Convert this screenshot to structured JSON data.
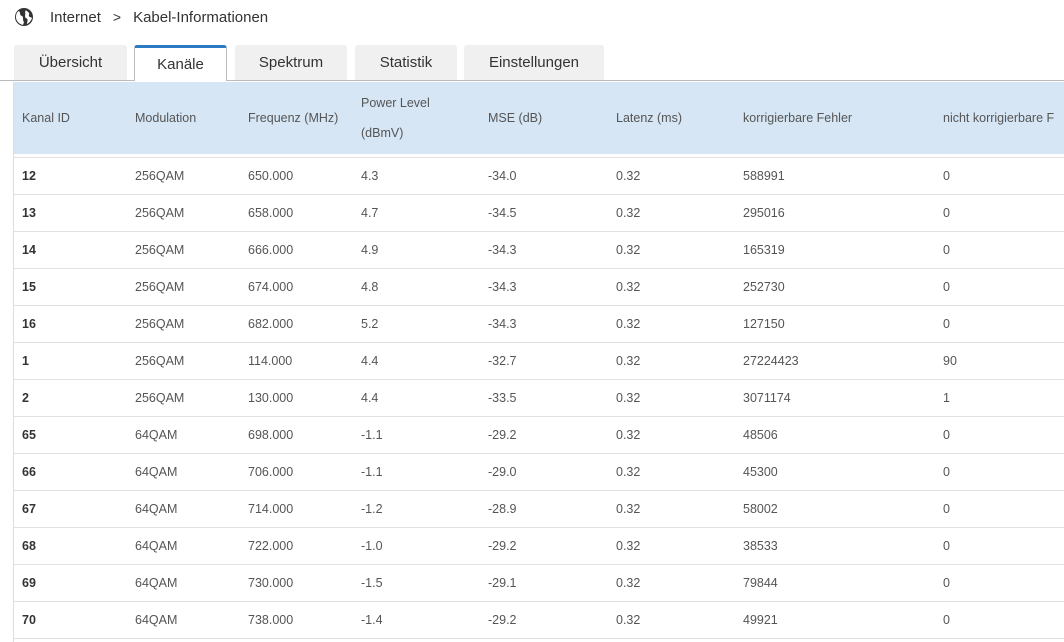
{
  "breadcrumb": {
    "items": [
      "Internet",
      "Kabel-Informationen"
    ],
    "separator": ">"
  },
  "tabs": [
    {
      "label": "Übersicht"
    },
    {
      "label": "Kanäle",
      "active": true
    },
    {
      "label": "Spektrum"
    },
    {
      "label": "Statistik"
    },
    {
      "label": "Einstellungen"
    }
  ],
  "table": {
    "headers": [
      "Kanal ID",
      "Modulation",
      "Frequenz (MHz)",
      "Power Level",
      "(dBmV)",
      "MSE (dB)",
      "Latenz (ms)",
      "korrigierbare Fehler",
      "nicht korrigierbare F"
    ],
    "rows": [
      [
        "12",
        "256QAM",
        "650.000",
        "4.3",
        "-34.0",
        "0.32",
        "588991",
        "0"
      ],
      [
        "13",
        "256QAM",
        "658.000",
        "4.7",
        "-34.5",
        "0.32",
        "295016",
        "0"
      ],
      [
        "14",
        "256QAM",
        "666.000",
        "4.9",
        "-34.3",
        "0.32",
        "165319",
        "0"
      ],
      [
        "15",
        "256QAM",
        "674.000",
        "4.8",
        "-34.3",
        "0.32",
        "252730",
        "0"
      ],
      [
        "16",
        "256QAM",
        "682.000",
        "5.2",
        "-34.3",
        "0.32",
        "127150",
        "0"
      ],
      [
        "1",
        "256QAM",
        "114.000",
        "4.4",
        "-32.7",
        "0.32",
        "27224423",
        "90"
      ],
      [
        "2",
        "256QAM",
        "130.000",
        "4.4",
        "-33.5",
        "0.32",
        "3071174",
        "1"
      ],
      [
        "65",
        "64QAM",
        "698.000",
        "-1.1",
        "-29.2",
        "0.32",
        "48506",
        "0"
      ],
      [
        "66",
        "64QAM",
        "706.000",
        "-1.1",
        "-29.0",
        "0.32",
        "45300",
        "0"
      ],
      [
        "67",
        "64QAM",
        "714.000",
        "-1.2",
        "-28.9",
        "0.32",
        "58002",
        "0"
      ],
      [
        "68",
        "64QAM",
        "722.000",
        "-1.0",
        "-29.2",
        "0.32",
        "38533",
        "0"
      ],
      [
        "69",
        "64QAM",
        "730.000",
        "-1.5",
        "-29.1",
        "0.32",
        "79844",
        "0"
      ],
      [
        "70",
        "64QAM",
        "738.000",
        "-1.4",
        "-29.2",
        "0.32",
        "49921",
        "0"
      ]
    ]
  },
  "colors": {
    "accent": "#2b7bc4",
    "header_bg": "#d6e6f5"
  }
}
